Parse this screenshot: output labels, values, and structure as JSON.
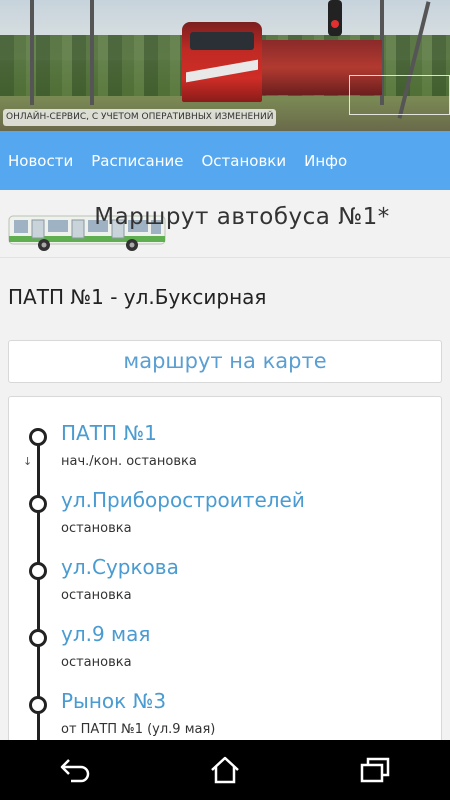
{
  "banner": {
    "caption": "ОНЛАЙН-СЕРВИС, С УЧЕТОМ ОПЕРАТИВНЫХ ИЗМЕНЕНИЙ"
  },
  "nav": {
    "items": [
      "Новости",
      "Расписание",
      "Остановки",
      "Инфо"
    ]
  },
  "route": {
    "title": "Маршрут автобуса №1*",
    "name": "ПАТП №1 - ул.Буксирная",
    "map_button": "маршрут на карте"
  },
  "stops": [
    {
      "name": "ПАТП №1",
      "type": "нач./кон. остановка"
    },
    {
      "name": "ул.Приборостроителей",
      "type": "остановка"
    },
    {
      "name": "ул.Суркова",
      "type": "остановка"
    },
    {
      "name": "ул.9 мая",
      "type": "остановка"
    },
    {
      "name": "Рынок №3",
      "type": "от ПАТП №1 (ул.9 мая)"
    }
  ],
  "icons": {
    "back": "back-icon",
    "home": "home-icon",
    "recents": "recents-icon",
    "bus": "bus-icon"
  },
  "colors": {
    "nav_bg": "#55a8ef",
    "link": "#4a9bd1"
  }
}
